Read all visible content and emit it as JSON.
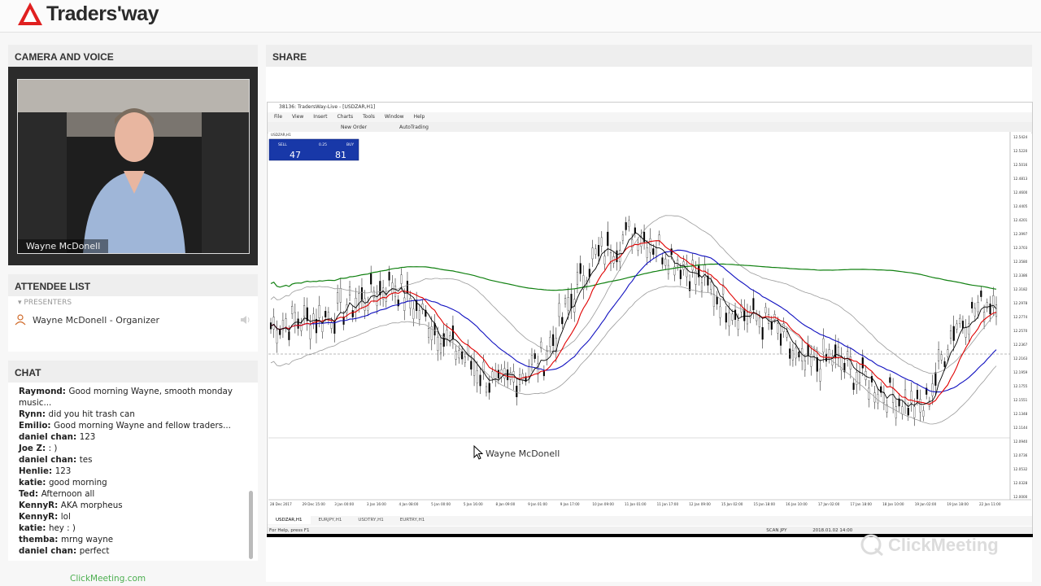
{
  "brand": {
    "name": "Traders'way"
  },
  "camera": {
    "title": "CAMERA AND VOICE",
    "presenter_name": "Wayne McDonell"
  },
  "attendees": {
    "title": "ATTENDEE LIST",
    "group_label": "PRESENTERS",
    "organizer": "Wayne McDonell - Organizer"
  },
  "chat": {
    "title": "CHAT",
    "messages": [
      {
        "author": "Raymond:",
        "text": "Good morning Wayne, smooth monday music..."
      },
      {
        "author": "Rynn:",
        "text": "did you hit trash can"
      },
      {
        "author": "Emilio:",
        "text": "Good morning Wayne and fellow traders..."
      },
      {
        "author": "daniel chan:",
        "text": "123"
      },
      {
        "author": "Joe Z:",
        "text": ": )"
      },
      {
        "author": "daniel chan:",
        "text": "tes"
      },
      {
        "author": "Henlie:",
        "text": "123"
      },
      {
        "author": "katie:",
        "text": "good morning"
      },
      {
        "author": "Ted:",
        "text": "Afternoon all"
      },
      {
        "author": "KennyR:",
        "text": "AKA morpheus"
      },
      {
        "author": "KennyR:",
        "text": "lol"
      },
      {
        "author": "katie:",
        "text": "hey : )"
      },
      {
        "author": "themba:",
        "text": "mrng wayne"
      },
      {
        "author": "daniel chan:",
        "text": "perfect"
      }
    ]
  },
  "footer": {
    "link": "ClickMeeting.com"
  },
  "share": {
    "title": "SHARE",
    "mt_title": "38136: TradersWay-Live - [USDZAR,H1]",
    "menu": [
      "File",
      "View",
      "Insert",
      "Charts",
      "Tools",
      "Window",
      "Help"
    ],
    "toolbar": [
      "New Order",
      "AutoTrading"
    ],
    "symbol_label": "USDZAR,H1",
    "sell_label": "SELL",
    "buy_label": "BUY",
    "lot": "0.25",
    "sell_price": "47",
    "buy_price": "81",
    "tabs": [
      "USDZAR,H1",
      "EURJPY,H1",
      "USDTRY,H1",
      "EURTRY,H1"
    ],
    "status_left": "For Help, press F1",
    "status_mid": "SCAN JPY",
    "status_right": "2018.01.02 14:00",
    "cursor_name": "Wayne McDonell",
    "watermark": "ClickMeeting"
  },
  "chart_data": {
    "type": "line",
    "title": "USDZAR,H1",
    "series": [
      {
        "name": "",
        "color": "#000000"
      },
      {
        "name": "",
        "color": "#e00000"
      },
      {
        "name": "",
        "color": "#1010c0"
      },
      {
        "name": "",
        "color": "#108010"
      }
    ],
    "colors": {
      "price": "#000000",
      "ma_fast": "#e00000",
      "ma_mid": "#1010c0",
      "ma_slow": "#108010",
      "bands": "#9a9a9a"
    },
    "x_labels": [
      "28 Dec 2017",
      "29 Dec 15:00",
      "3 Jan 00:00",
      "3 Jan 16:00",
      "4 Jan 08:00",
      "5 Jan 00:00",
      "5 Jan 16:00",
      "8 Jan 09:00",
      "9 Jan 01:00",
      "9 Jan 17:00",
      "10 Jan 09:00",
      "11 Jan 01:00",
      "11 Jan 17:00",
      "12 Jan 09:00",
      "15 Jan 02:00",
      "15 Jan 18:00",
      "16 Jan 10:00",
      "17 Jan 02:00",
      "17 Jan 18:00",
      "18 Jan 10:00",
      "19 Jan 02:00",
      "19 Jan 18:00",
      "22 Jan 11:00"
    ],
    "y_labels": [
      "12.5424",
      "12.5220",
      "12.5016",
      "12.4813",
      "12.4600",
      "12.4405",
      "12.4201",
      "12.3997",
      "12.3703",
      "12.3580",
      "12.3386",
      "12.3182",
      "12.2978",
      "12.2774",
      "12.2570",
      "12.2367",
      "12.2163",
      "12.1959",
      "12.1755",
      "12.1551",
      "12.1348",
      "12.1144",
      "12.0940",
      "12.0736",
      "12.0532",
      "12.0328",
      "12.0000"
    ]
  }
}
